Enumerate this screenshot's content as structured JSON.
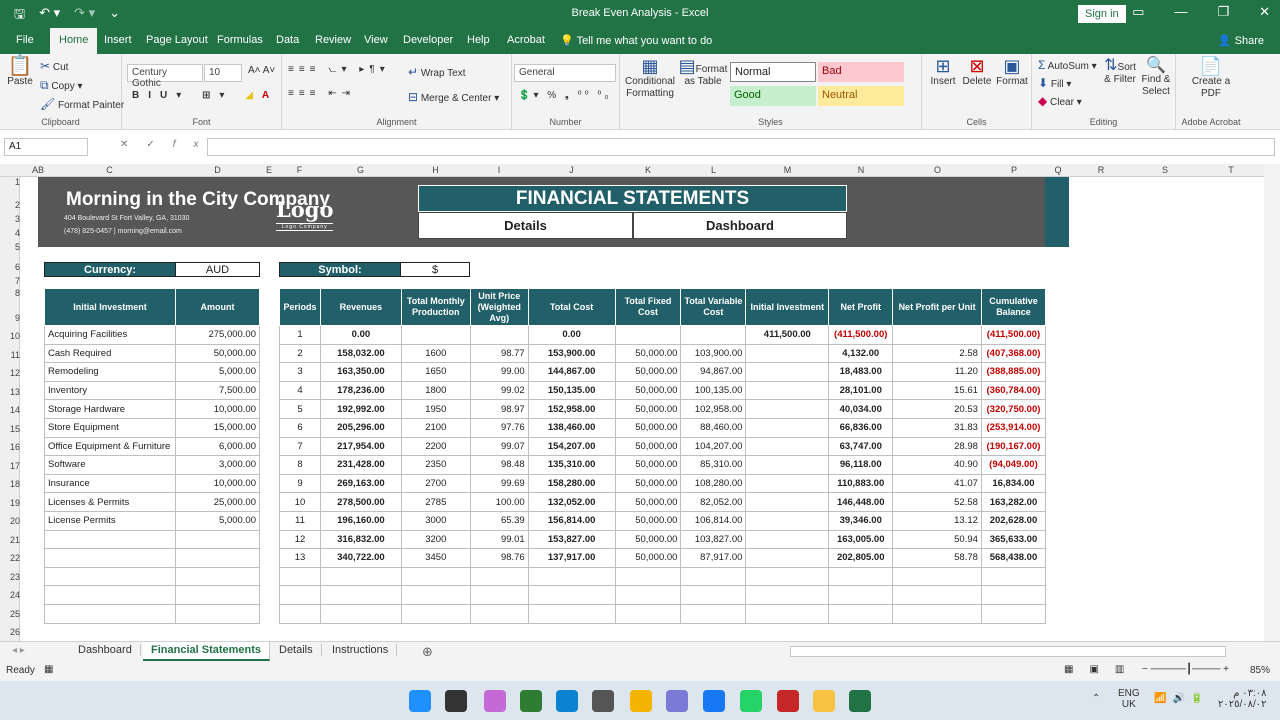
{
  "window": {
    "title": "Break Even Analysis  -  Excel",
    "sign_in": "Sign in",
    "share": "Share"
  },
  "menu": [
    "File",
    "Home",
    "Insert",
    "Page Layout",
    "Formulas",
    "Data",
    "Review",
    "View",
    "Developer",
    "Help",
    "Acrobat",
    "Tell me what you want to do"
  ],
  "ribbon": {
    "clipboard": {
      "paste": "Paste",
      "cut": "Cut",
      "copy": "Copy",
      "format_painter": "Format Painter",
      "label": "Clipboard"
    },
    "font": {
      "name": "Century Gothic",
      "size": "10",
      "label": "Font"
    },
    "alignment": {
      "wrap": "Wrap Text",
      "merge": "Merge & Center",
      "label": "Alignment"
    },
    "number": {
      "format": "General",
      "label": "Number"
    },
    "styles": {
      "conditional": "Conditional Formatting",
      "format_table": "Format as Table",
      "normal": "Normal",
      "bad": "Bad",
      "good": "Good",
      "neutral": "Neutral",
      "label": "Styles"
    },
    "cells": {
      "insert": "Insert",
      "delete": "Delete",
      "format": "Format",
      "label": "Cells"
    },
    "editing": {
      "autosum": "AutoSum",
      "fill": "Fill",
      "clear": "Clear",
      "sort": "Sort & Filter",
      "find": "Find & Select",
      "label": "Editing"
    },
    "acrobat": {
      "create": "Create a PDF",
      "label": "Adobe Acrobat"
    }
  },
  "formula_bar": {
    "name_box": "A1",
    "formula": ""
  },
  "columns": [
    "A",
    "B",
    "C",
    "D",
    "E",
    "F",
    "G",
    "H",
    "I",
    "J",
    "K",
    "L",
    "M",
    "N",
    "O",
    "P",
    "Q",
    "R",
    "S",
    "T"
  ],
  "rows": [
    "1",
    "2",
    "3",
    "4",
    "5",
    "6",
    "7",
    "8",
    "9",
    "10",
    "11",
    "12",
    "13",
    "14",
    "15",
    "16",
    "17",
    "18",
    "19",
    "20",
    "21",
    "22",
    "23",
    "24",
    "25",
    "26"
  ],
  "sheet": {
    "company": "Morning in the City Company",
    "address": "404 Boulevard St Fort Valley, GA, 31030",
    "contact": "(478) 825-0457  |  morning@email.com",
    "logo": "Logo",
    "logo_sub": "Logo Company",
    "title": "FINANCIAL STATEMENTS",
    "nav_details": "Details",
    "nav_dashboard": "Dashboard",
    "currency_label": "Currency:",
    "currency_value": "AUD",
    "symbol_label": "Symbol:",
    "symbol_value": "$"
  },
  "investment": {
    "headers": [
      "Initial Investment",
      "Amount"
    ],
    "rows": [
      [
        "Acquiring Facilities",
        "275,000.00"
      ],
      [
        "Cash Required",
        "50,000.00"
      ],
      [
        "Remodeling",
        "5,000.00"
      ],
      [
        "Inventory",
        "7,500.00"
      ],
      [
        "Storage Hardware",
        "10,000.00"
      ],
      [
        "Store Equipment",
        "15,000.00"
      ],
      [
        "Office Equipment & Furniture",
        "6,000.00"
      ],
      [
        "Software",
        "3,000.00"
      ],
      [
        "Insurance",
        "10,000.00"
      ],
      [
        "Licenses & Permits",
        "25,000.00"
      ],
      [
        "License Permits",
        "5,000.00"
      ],
      [
        "",
        ""
      ],
      [
        "",
        ""
      ],
      [
        "",
        ""
      ],
      [
        "",
        ""
      ],
      [
        "",
        ""
      ]
    ]
  },
  "periods": {
    "headers": [
      "Periods",
      "Revenues",
      "Total Monthly Production",
      "Unit Price (Weighted Avg)",
      "Total Cost",
      "Total Fixed Cost",
      "Total Variable Cost",
      "Initial Investment",
      "Net Profit",
      "Net Profit per Unit",
      "Cumulative Balance"
    ],
    "rows": [
      [
        "1",
        "0.00",
        "",
        "",
        "0.00",
        "",
        "",
        "411,500.00",
        "(411,500.00)",
        "",
        "(411,500.00)"
      ],
      [
        "2",
        "158,032.00",
        "1600",
        "98.77",
        "153,900.00",
        "50,000.00",
        "103,900.00",
        "",
        "4,132.00",
        "2.58",
        "(407,368.00)"
      ],
      [
        "3",
        "163,350.00",
        "1650",
        "99.00",
        "144,867.00",
        "50,000.00",
        "94,867.00",
        "",
        "18,483.00",
        "11.20",
        "(388,885.00)"
      ],
      [
        "4",
        "178,236.00",
        "1800",
        "99.02",
        "150,135.00",
        "50,000.00",
        "100,135.00",
        "",
        "28,101.00",
        "15.61",
        "(360,784.00)"
      ],
      [
        "5",
        "192,992.00",
        "1950",
        "98.97",
        "152,958.00",
        "50,000.00",
        "102,958.00",
        "",
        "40,034.00",
        "20.53",
        "(320,750.00)"
      ],
      [
        "6",
        "205,296.00",
        "2100",
        "97.76",
        "138,460.00",
        "50,000.00",
        "88,460.00",
        "",
        "66,836.00",
        "31.83",
        "(253,914.00)"
      ],
      [
        "7",
        "217,954.00",
        "2200",
        "99.07",
        "154,207.00",
        "50,000.00",
        "104,207.00",
        "",
        "63,747.00",
        "28.98",
        "(190,167.00)"
      ],
      [
        "8",
        "231,428.00",
        "2350",
        "98.48",
        "135,310.00",
        "50,000.00",
        "85,310.00",
        "",
        "96,118.00",
        "40.90",
        "(94,049.00)"
      ],
      [
        "9",
        "269,163.00",
        "2700",
        "99.69",
        "158,280.00",
        "50,000.00",
        "108,280.00",
        "",
        "110,883.00",
        "41.07",
        "16,834.00"
      ],
      [
        "10",
        "278,500.00",
        "2785",
        "100.00",
        "132,052.00",
        "50,000.00",
        "82,052.00",
        "",
        "146,448.00",
        "52.58",
        "163,282.00"
      ],
      [
        "11",
        "196,160.00",
        "3000",
        "65.39",
        "156,814.00",
        "50,000.00",
        "106,814.00",
        "",
        "39,346.00",
        "13.12",
        "202,628.00"
      ],
      [
        "12",
        "316,832.00",
        "3200",
        "99.01",
        "153,827.00",
        "50,000.00",
        "103,827.00",
        "",
        "163,005.00",
        "50.94",
        "365,633.00"
      ],
      [
        "13",
        "340,722.00",
        "3450",
        "98.76",
        "137,917.00",
        "50,000.00",
        "87,917.00",
        "",
        "202,805.00",
        "58.78",
        "568,438.00"
      ],
      [
        "",
        "",
        "",
        "",
        "",
        "",
        "",
        "",
        "",
        "",
        ""
      ],
      [
        "",
        "",
        "",
        "",
        "",
        "",
        "",
        "",
        "",
        "",
        ""
      ],
      [
        "",
        "",
        "",
        "",
        "",
        "",
        "",
        "",
        "",
        "",
        ""
      ]
    ]
  },
  "sheet_tabs": [
    "Dashboard",
    "Financial Statements",
    "Details",
    "Instructions"
  ],
  "active_tab": "Financial Statements",
  "status": {
    "ready": "Ready",
    "zoom": "85%"
  },
  "taskbar": {
    "lang": "ENG",
    "region": "UK",
    "time": "٠٣:٠٨ م",
    "date": "٢٠٢٥/٠٨/٠٢"
  },
  "colors": {
    "excel_green": "#217346",
    "teal": "#215f69",
    "banner": "#575757",
    "negative": "#c00000"
  }
}
